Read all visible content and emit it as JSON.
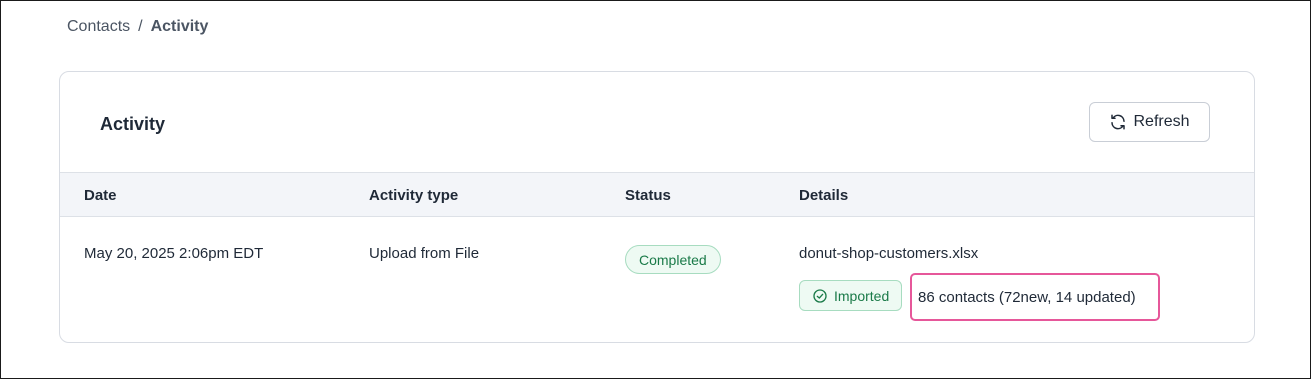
{
  "breadcrumb": {
    "parent": "Contacts",
    "separator": "/",
    "current": "Activity"
  },
  "card": {
    "title": "Activity",
    "refresh_label": "Refresh"
  },
  "table": {
    "columns": [
      "Date",
      "Activity type",
      "Status",
      "Details"
    ],
    "rows": [
      {
        "date": "May 20, 2025 2:06pm EDT",
        "activity_type": "Upload from File",
        "status": "Completed",
        "file_name": "donut-shop-customers.xlsx",
        "detail_badge": "Imported",
        "summary": "86 contacts (72new, 14 updated)"
      }
    ]
  },
  "colors": {
    "success_text": "#1a7a48",
    "success_bg": "#eefaf3",
    "highlight": "#e6579a",
    "header_bg": "#f3f5f9"
  },
  "icons": {
    "refresh": "refresh-icon",
    "imported": "check-circle-icon"
  }
}
